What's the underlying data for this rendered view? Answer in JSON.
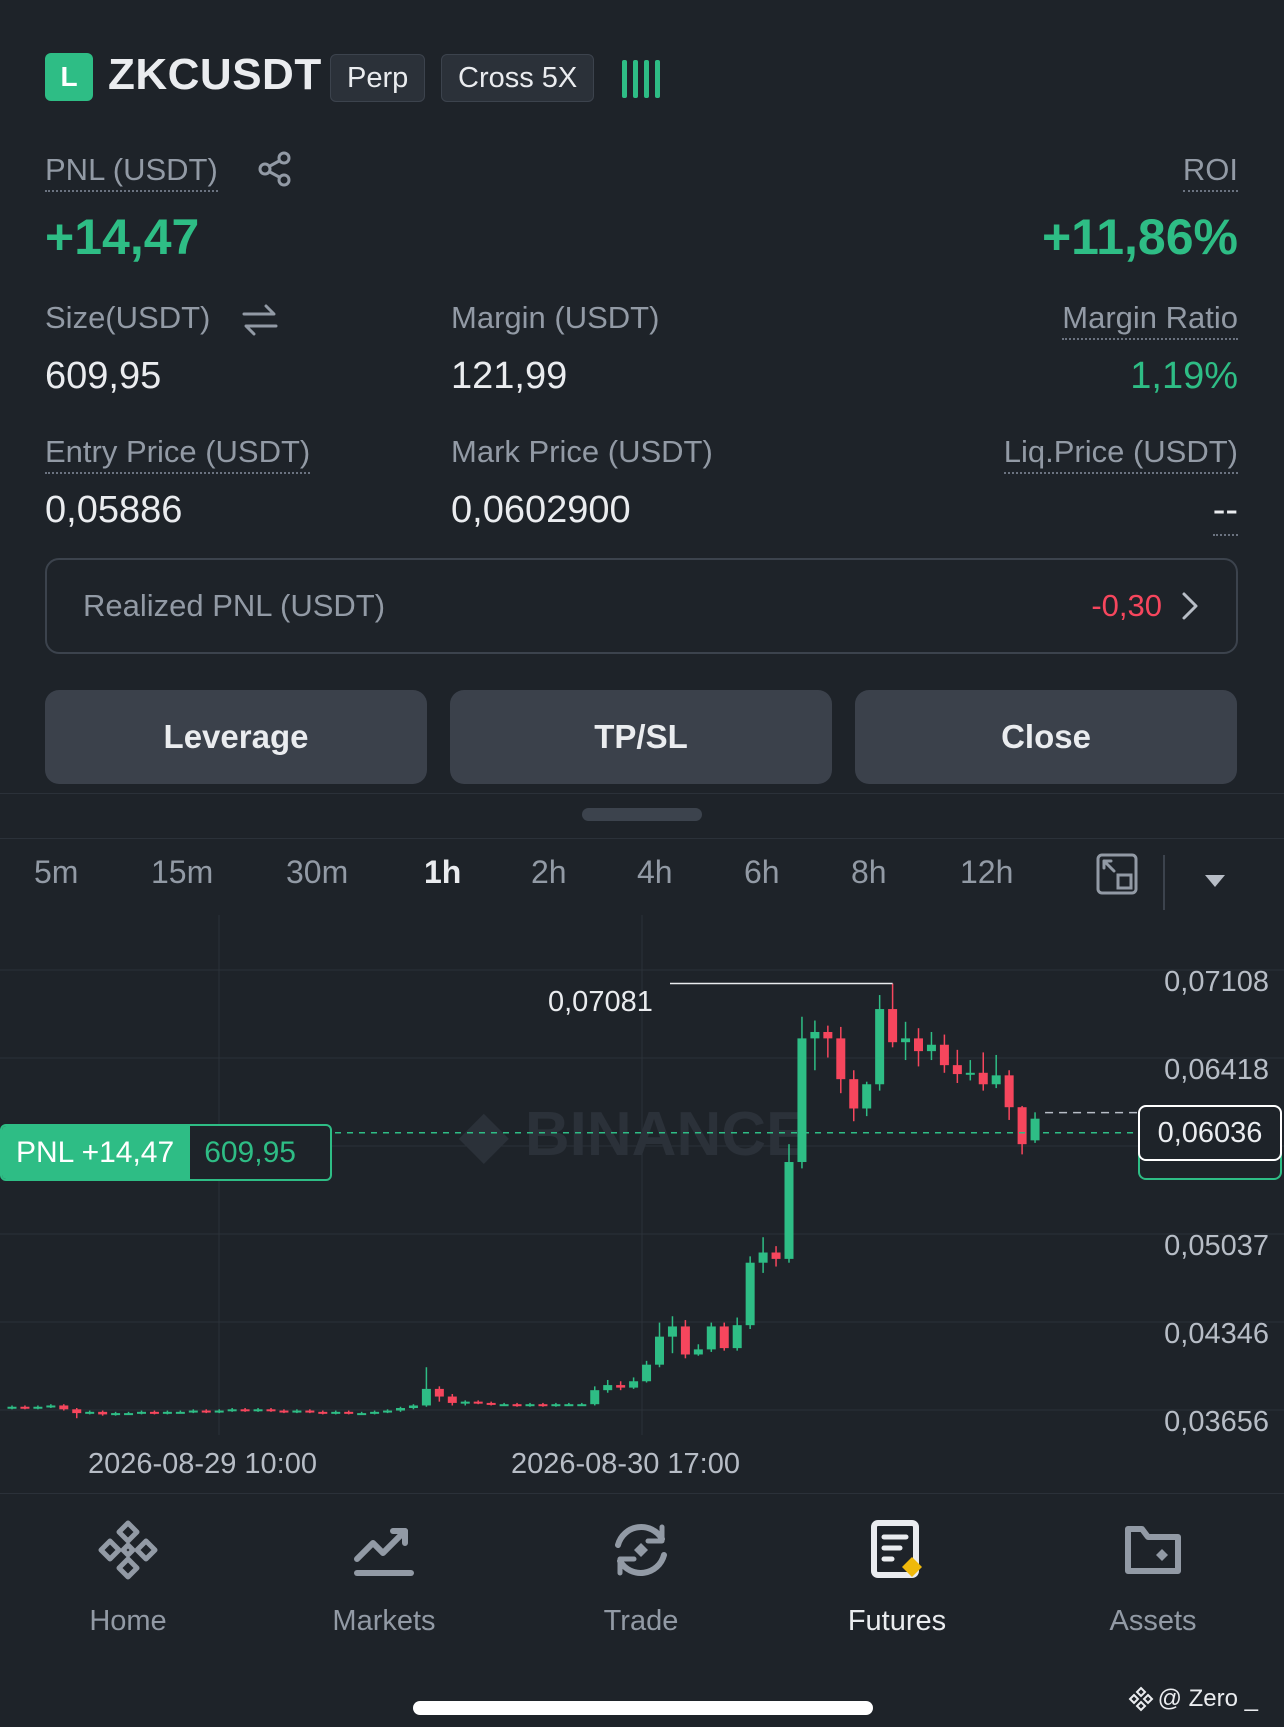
{
  "header": {
    "side_badge": "L",
    "symbol": "ZKCUSDT",
    "contract_type": "Perp",
    "margin_mode": "Cross 5X",
    "signal_icon": "signal-bars-icon"
  },
  "position": {
    "pnl_label": "PNL (USDT)",
    "pnl_value": "+14,47",
    "roi_label": "ROI",
    "roi_value": "+11,86%",
    "size_label": "Size(USDT)",
    "size_value": "609,95",
    "margin_label": "Margin (USDT)",
    "margin_value": "121,99",
    "margin_ratio_label": "Margin Ratio",
    "margin_ratio_value": "1,19%",
    "entry_label": "Entry Price (USDT)",
    "entry_value": "0,05886",
    "mark_label": "Mark Price (USDT)",
    "mark_value": "0,0602900",
    "liq_label": "Liq.Price (USDT)",
    "liq_value": "--"
  },
  "realized": {
    "label": "Realized PNL (USDT)",
    "value": "-0,30"
  },
  "actions": {
    "leverage": "Leverage",
    "tpsl": "TP/SL",
    "close": "Close"
  },
  "timeframes": [
    "5m",
    "15m",
    "30m",
    "1h",
    "2h",
    "4h",
    "6h",
    "8h",
    "12h"
  ],
  "active_timeframe": "1h",
  "chart": {
    "price_labels": [
      "0,07108",
      "0,06418",
      "0,05037",
      "0,04346",
      "0,03656"
    ],
    "date_labels": [
      "2026-08-29 10:00",
      "2026-08-30 17:00"
    ],
    "high_label": "0,07081",
    "current_price": "0,06036",
    "pnl_tag_label": "PNL +14,47",
    "pnl_tag_size": "609,95",
    "watermark": "BINANCE",
    "colors": {
      "up": "#2ebd85",
      "down": "#f6465d"
    }
  },
  "chart_data": {
    "type": "candlestick",
    "ylim": [
      0.03656,
      0.07108
    ],
    "y_ticks": [
      0.07108,
      0.06418,
      0.05037,
      0.04346,
      0.03656
    ],
    "x_tick_labels": [
      "2026-08-29 10:00",
      "2026-08-30 17:00"
    ],
    "high_marker": 0.07081,
    "current_price": 0.06036,
    "entry_price": 0.05886,
    "candles": [
      [
        0.0375,
        0.0376,
        0.0377,
        0.0374
      ],
      [
        0.0376,
        0.0375,
        0.0377,
        0.0374
      ],
      [
        0.0375,
        0.0376,
        0.0377,
        0.0374
      ],
      [
        0.0376,
        0.0377,
        0.0378,
        0.0375
      ],
      [
        0.0377,
        0.0374,
        0.0378,
        0.0373
      ],
      [
        0.0374,
        0.0371,
        0.0375,
        0.0367
      ],
      [
        0.0371,
        0.0372,
        0.0373,
        0.037
      ],
      [
        0.0372,
        0.037,
        0.0373,
        0.0369
      ],
      [
        0.037,
        0.0371,
        0.0372,
        0.0369
      ],
      [
        0.0371,
        0.0371,
        0.0372,
        0.037
      ],
      [
        0.0371,
        0.0372,
        0.0373,
        0.037
      ],
      [
        0.0372,
        0.0371,
        0.0373,
        0.037
      ],
      [
        0.0371,
        0.0372,
        0.0373,
        0.037
      ],
      [
        0.0372,
        0.0372,
        0.0373,
        0.0371
      ],
      [
        0.0372,
        0.0373,
        0.0374,
        0.0371
      ],
      [
        0.0373,
        0.0372,
        0.0374,
        0.0371
      ],
      [
        0.0372,
        0.0373,
        0.0374,
        0.0371
      ],
      [
        0.0373,
        0.0374,
        0.0375,
        0.0372
      ],
      [
        0.0374,
        0.0373,
        0.0375,
        0.0372
      ],
      [
        0.0373,
        0.0374,
        0.0375,
        0.0372
      ],
      [
        0.0374,
        0.0373,
        0.0375,
        0.0372
      ],
      [
        0.0373,
        0.0372,
        0.0374,
        0.0371
      ],
      [
        0.0372,
        0.0373,
        0.0374,
        0.0371
      ],
      [
        0.0373,
        0.0372,
        0.0374,
        0.0371
      ],
      [
        0.0372,
        0.0371,
        0.0373,
        0.037
      ],
      [
        0.0371,
        0.0372,
        0.0373,
        0.037
      ],
      [
        0.0372,
        0.0371,
        0.0373,
        0.037
      ],
      [
        0.0371,
        0.0371,
        0.0372,
        0.037
      ],
      [
        0.0371,
        0.0372,
        0.0373,
        0.037
      ],
      [
        0.0372,
        0.0373,
        0.0374,
        0.0371
      ],
      [
        0.0373,
        0.0375,
        0.0376,
        0.0372
      ],
      [
        0.0375,
        0.0377,
        0.0378,
        0.0374
      ],
      [
        0.0377,
        0.039,
        0.0407,
        0.0376
      ],
      [
        0.039,
        0.0384,
        0.0392,
        0.038
      ],
      [
        0.0384,
        0.0379,
        0.0386,
        0.0377
      ],
      [
        0.0379,
        0.038,
        0.0381,
        0.0377
      ],
      [
        0.038,
        0.0379,
        0.0381,
        0.0378
      ],
      [
        0.0379,
        0.0378,
        0.038,
        0.0377
      ],
      [
        0.0378,
        0.0378,
        0.0379,
        0.0377
      ],
      [
        0.0378,
        0.0377,
        0.0379,
        0.0376
      ],
      [
        0.0377,
        0.0378,
        0.0379,
        0.0376
      ],
      [
        0.0378,
        0.0377,
        0.0379,
        0.0376
      ],
      [
        0.0377,
        0.0378,
        0.0379,
        0.0376
      ],
      [
        0.0378,
        0.0378,
        0.0379,
        0.0377
      ],
      [
        0.0378,
        0.0378,
        0.0379,
        0.0377
      ],
      [
        0.0378,
        0.0389,
        0.0392,
        0.0377
      ],
      [
        0.0389,
        0.0393,
        0.0397,
        0.0387
      ],
      [
        0.0393,
        0.0391,
        0.0396,
        0.0389
      ],
      [
        0.0391,
        0.0396,
        0.0399,
        0.039
      ],
      [
        0.0396,
        0.0409,
        0.0412,
        0.0395
      ],
      [
        0.0409,
        0.0431,
        0.0442,
        0.0407
      ],
      [
        0.0431,
        0.0439,
        0.0447,
        0.0418
      ],
      [
        0.0439,
        0.0417,
        0.0444,
        0.0414
      ],
      [
        0.0417,
        0.0421,
        0.0425,
        0.0416
      ],
      [
        0.0421,
        0.0439,
        0.0442,
        0.0419
      ],
      [
        0.0439,
        0.0422,
        0.0442,
        0.042
      ],
      [
        0.0422,
        0.044,
        0.0446,
        0.042
      ],
      [
        0.044,
        0.0489,
        0.0494,
        0.0437
      ],
      [
        0.0489,
        0.0497,
        0.0509,
        0.0481
      ],
      [
        0.0497,
        0.0492,
        0.0502,
        0.0486
      ],
      [
        0.0492,
        0.0568,
        0.0582,
        0.0489
      ],
      [
        0.0568,
        0.0665,
        0.0682,
        0.0563
      ],
      [
        0.0665,
        0.067,
        0.0679,
        0.064
      ],
      [
        0.067,
        0.0665,
        0.0675,
        0.065
      ],
      [
        0.0665,
        0.0633,
        0.0674,
        0.0622
      ],
      [
        0.0633,
        0.061,
        0.064,
        0.06
      ],
      [
        0.061,
        0.0629,
        0.0631,
        0.0604
      ],
      [
        0.0629,
        0.0688,
        0.0699,
        0.0624
      ],
      [
        0.0688,
        0.0662,
        0.0708,
        0.0658
      ],
      [
        0.0662,
        0.0665,
        0.0678,
        0.0648
      ],
      [
        0.0665,
        0.0655,
        0.0673,
        0.0643
      ],
      [
        0.0655,
        0.066,
        0.067,
        0.0648
      ],
      [
        0.066,
        0.0644,
        0.0668,
        0.0638
      ],
      [
        0.0644,
        0.0637,
        0.0656,
        0.063
      ],
      [
        0.0637,
        0.0638,
        0.0648,
        0.0632
      ],
      [
        0.0638,
        0.0629,
        0.0654,
        0.0624
      ],
      [
        0.0629,
        0.0636,
        0.0652,
        0.0626
      ],
      [
        0.0636,
        0.0611,
        0.064,
        0.0601
      ],
      [
        0.0611,
        0.0582,
        0.0612,
        0.0574
      ],
      [
        0.0585,
        0.0602,
        0.0607,
        0.0583
      ]
    ]
  },
  "bottom_nav": [
    {
      "label": "Home",
      "icon": "binance-logo-icon"
    },
    {
      "label": "Markets",
      "icon": "trend-chart-icon"
    },
    {
      "label": "Trade",
      "icon": "trade-swap-icon"
    },
    {
      "label": "Futures",
      "icon": "futures-document-icon"
    },
    {
      "label": "Assets",
      "icon": "wallet-icon"
    }
  ],
  "footer_watermark": "@ Zero _"
}
